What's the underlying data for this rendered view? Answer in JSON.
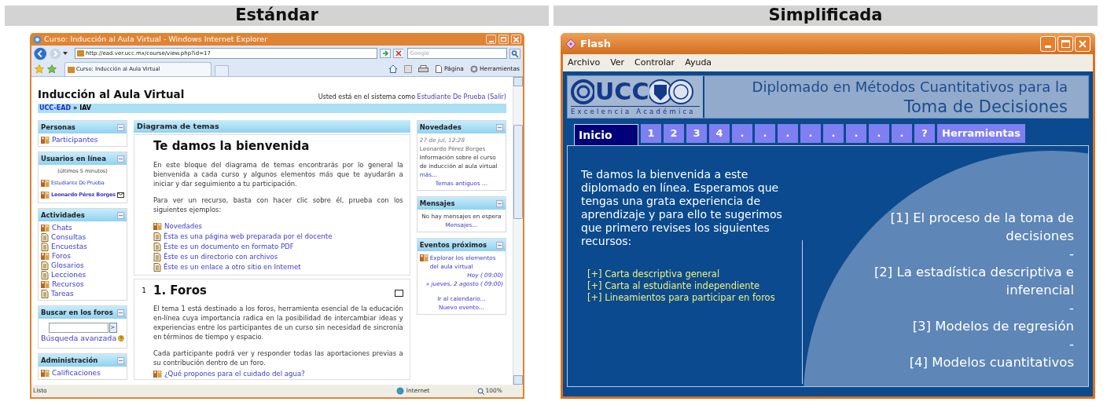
{
  "standard": {
    "heading": "Estándar",
    "window": {
      "title": "Curso: Inducción al Aula Virtual - Windows Internet Explorer"
    },
    "address": "http://ead.ver.ucc.mx/course/view.php?id=17",
    "search": {
      "placeholder": "Google"
    },
    "tab": {
      "label": "Curso: Inducción al Aula Virtual"
    },
    "toolbar": [
      "Página",
      "Herramientas"
    ],
    "page": {
      "title": "Inducción al Aula Virtual",
      "login_prefix": "Usted está en el sistema como",
      "login_user": "Estudiante De Prueba",
      "logout": "(Salir)",
      "breadcrumb": {
        "link": "UCC-EAD",
        "separator": "»",
        "current": "IAV"
      },
      "left_blocks": [
        {
          "kind": "links",
          "title": "Personas",
          "items": [
            "Participantes"
          ]
        },
        {
          "kind": "users",
          "title": "Usuarios en línea",
          "note": "(últimos 5 minutos)",
          "users": [
            {
              "name": "Estudiante De Prueba",
              "kind": "student"
            },
            {
              "name": "Leonardo Pérez Borges",
              "kind": "teacher"
            }
          ]
        },
        {
          "kind": "links",
          "title": "Actividades",
          "items": [
            "Chats",
            "Consultas",
            "Encuestas",
            "Foros",
            "Glosarios",
            "Lecciones",
            "Recursos",
            "Tareas"
          ]
        },
        {
          "kind": "search",
          "title": "Buscar en los foros",
          "button": ">",
          "link": "Búsqueda avanzada"
        },
        {
          "kind": "links",
          "title": "Administración",
          "items": [
            "Calificaciones"
          ]
        }
      ],
      "center": {
        "header": "Diagrama de temas",
        "welcome": {
          "heading": "Te damos la bienvenida",
          "paragraphs": [
            "En este bloque del diagrama de temas encontrarás por lo general la bienvenida a cada curso y algunos elementos más que te ayudarán a iniciar y dar seguimiento a tu participación.",
            "Para ver un recurso, basta con hacer clic sobre él, prueba con los siguientes ejemplos:"
          ],
          "resources": [
            "Novedades",
            "Ésta es una página web preparada por el docente",
            "Éste es un documento en formato PDF",
            "Éste es un directorio con archivos",
            "Éste es un enlace a otro sitio en Internet"
          ]
        },
        "topic": {
          "number": "1",
          "heading": "1. Foros",
          "paragraphs": [
            "El tema 1 está destinado a los foros, herramienta esencial de la educación en-línea cuya importancia radica en la posibilidad de intercambiar ideas y experiencias entre los participantes de un curso sin necesidad de sincronía en términos de tiempo y espacio.",
            "Cada participante podrá ver y responder todas las aportaciones previas a su contribución dentro de un foro."
          ],
          "link": "¿Qué propones para el cuidado del agua?"
        }
      },
      "right_blocks": [
        {
          "kind": "news",
          "title": "Novedades",
          "date": "27 de jul, 12:28",
          "author": "Leonardo Pérez Borges",
          "text": "Información sobre el curso de inducción al aula virtual",
          "more": "más...",
          "link": "Temas antiguos ..."
        },
        {
          "kind": "messages",
          "title": "Mensajes",
          "text": "No hay mensajes en espera",
          "link": "Mensajes..."
        },
        {
          "kind": "events",
          "title": "Eventos próximos",
          "event": "Explorar los elementos del aula virtual",
          "times": [
            "Hoy ( 09:00)",
            "» jueves, 2 agosto ( 09:00)"
          ],
          "links": [
            "Ir al calendario...",
            "Nuevo evento..."
          ]
        }
      ]
    },
    "status_bar": {
      "text": "Listo",
      "zone": "Internet",
      "zoom": "100%"
    }
  },
  "simplified": {
    "heading": "Simplificada",
    "window": {
      "title": "Flash"
    },
    "menu": [
      "Archivo",
      "Ver",
      "Controlar",
      "Ayuda"
    ],
    "logo": {
      "text": "UCC",
      "motto": "Excelencia Académica"
    },
    "title_lines": [
      "Diplomado en Métodos Cuantitativos para la",
      "Toma de Decisiones"
    ],
    "tabs": [
      {
        "label": "Inicio",
        "selected": true
      },
      {
        "label": "1",
        "selected": false
      },
      {
        "label": "2",
        "selected": false
      },
      {
        "label": "3",
        "selected": false
      },
      {
        "label": "4",
        "selected": false
      },
      {
        "label": ".",
        "selected": false
      },
      {
        "label": ".",
        "selected": false
      },
      {
        "label": ".",
        "selected": false
      },
      {
        "label": ".",
        "selected": false
      },
      {
        "label": ".",
        "selected": false
      },
      {
        "label": ".",
        "selected": false
      },
      {
        "label": ".",
        "selected": false
      },
      {
        "label": ".",
        "selected": false
      },
      {
        "label": "?",
        "selected": false
      },
      {
        "label": "Herramientas",
        "selected": false
      }
    ],
    "intro": "Te damos la bienvenida a este diplomado en línea. Esperamos que tengas una grata experiencia de aprendizaje y para ello te sugerimos que primero revises los siguientes recursos:",
    "links": [
      "[+] Carta descriptiva general",
      "[+] Carta al estudiante independiente",
      "[+] Lineamientos para participar en foros"
    ],
    "topics": [
      {
        "kind": "topic",
        "text": "[1] El proceso de la toma de decisiones"
      },
      {
        "kind": "separator",
        "text": "-"
      },
      {
        "kind": "topic",
        "text": "[2] La estadística descriptiva e inferencial"
      },
      {
        "kind": "separator",
        "text": "-"
      },
      {
        "kind": "topic",
        "text": "[3] Modelos de regresión"
      },
      {
        "kind": "separator",
        "text": "-"
      },
      {
        "kind": "topic",
        "text": "[4] Modelos cuantitativos"
      }
    ]
  }
}
